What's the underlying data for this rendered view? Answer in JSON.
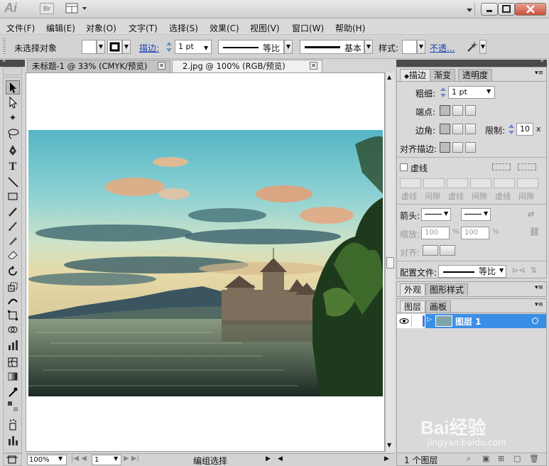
{
  "app": {
    "logo": "Ai",
    "bridge": "Br",
    "window_controls": [
      "minimize",
      "restore",
      "close"
    ]
  },
  "menu": [
    "文件(F)",
    "编辑(E)",
    "对象(O)",
    "文字(T)",
    "选择(S)",
    "效果(C)",
    "视图(V)",
    "窗口(W)",
    "帮助(H)"
  ],
  "control_bar": {
    "selection_status": "未选择对象",
    "stroke_link": "描边:",
    "stroke_weight": "1 pt",
    "stroke_profile": "等比",
    "brush": "基本",
    "style_label": "样式:",
    "opacity_link": "不透..."
  },
  "tabs": [
    {
      "label": "未标题-1 @ 33% (CMYK/预览)",
      "active": false
    },
    {
      "label": "2.jpg @ 100% (RGB/预览)",
      "active": true
    }
  ],
  "status_bar": {
    "zoom": "100%",
    "artboard": "1",
    "mode": "编组选择"
  },
  "stroke_panel": {
    "tabs": [
      "描边",
      "渐变",
      "透明度"
    ],
    "weight_label": "粗细:",
    "weight_value": "1 pt",
    "cap_label": "端点:",
    "corner_label": "边角:",
    "limit_label": "限制:",
    "limit_value": "10",
    "limit_unit": "x",
    "align_label": "对齐描边:",
    "dashed_label": "虚线",
    "dash_labels": [
      "虚线",
      "间隙",
      "虚线",
      "间隙",
      "虚线",
      "间隙"
    ],
    "arrow_label": "箭头:",
    "scale_label": "缩放:",
    "scale_1": "100",
    "scale_2": "100",
    "scale_unit": "%",
    "align_arrow_label": "对齐:",
    "profile_label": "配置文件:",
    "profile_value": "等比"
  },
  "appearance_panel": {
    "tabs": [
      "外观",
      "图形样式"
    ]
  },
  "layers_panel": {
    "tabs": [
      "图层",
      "画板"
    ],
    "layer_name": "图层 1",
    "layer_count": "1 个图层"
  },
  "watermark": {
    "brand": "Bai经验",
    "url": "jingyan.baidu.com"
  }
}
